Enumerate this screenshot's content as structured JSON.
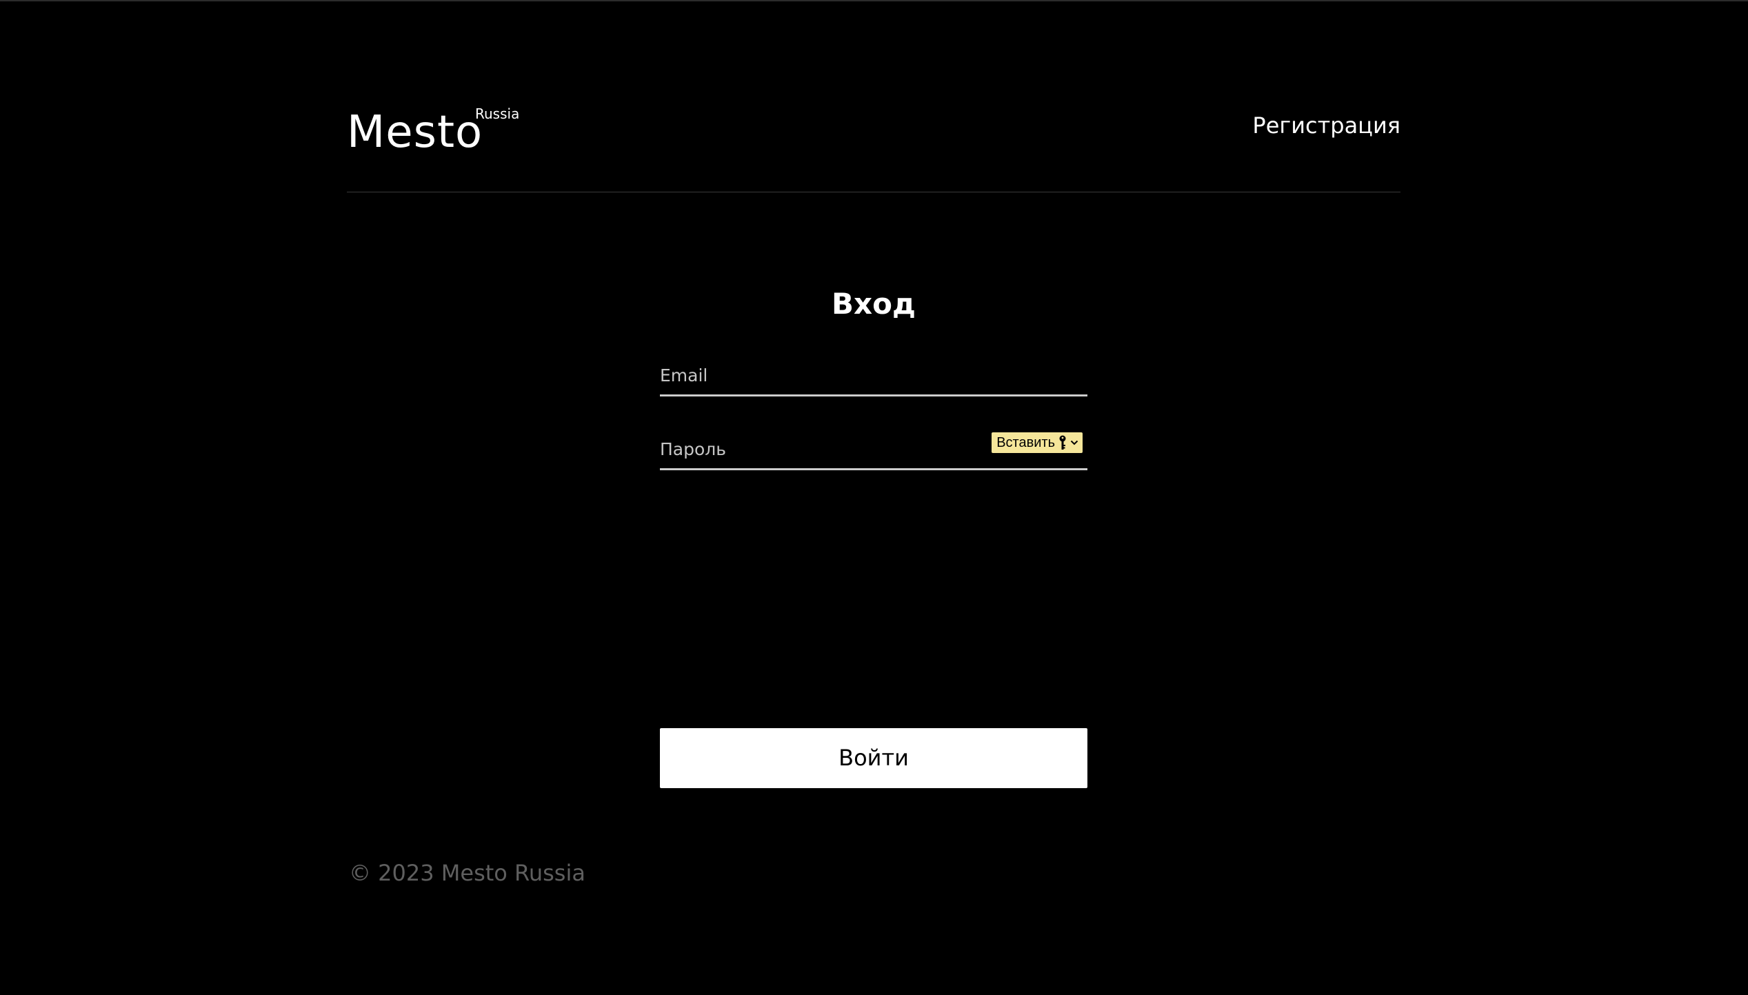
{
  "header": {
    "logo_main": "Mesto",
    "logo_sup": "Russia",
    "register_link": "Регистрация"
  },
  "form": {
    "title": "Вход",
    "email": {
      "placeholder": "Email",
      "value": ""
    },
    "password": {
      "placeholder": "Пароль",
      "value": ""
    },
    "insert_button_label": "Вставить",
    "insert_button_icon": "key-icon",
    "submit_label": "Войти"
  },
  "footer": {
    "copyright": "© 2023 Mesto Russia"
  },
  "colors": {
    "background": "#000000",
    "text": "#ffffff",
    "footer_text": "#5f5f5f",
    "insert_button_bg": "#f5e69a"
  }
}
